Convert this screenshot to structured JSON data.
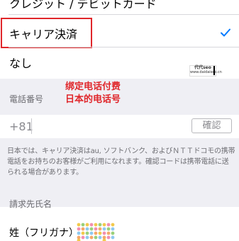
{
  "payment_options": {
    "credit_label": "クレジット / デビットカード",
    "carrier_label": "キャリア決済",
    "none_label": "なし",
    "selected": "carrier",
    "accent_color": "#007aff"
  },
  "phone_section": {
    "header": "電話番号",
    "country_code": "+81",
    "verify_label": "確認"
  },
  "annotation": {
    "line1": "绑定电话付费",
    "line2": "日本的电话号",
    "color": "#e0262a"
  },
  "watermark": {
    "line1": "代代seo",
    "line2": "www.daidaiseo.cn"
  },
  "notice_text": "日本では、キャリア決済はau, ソフトバンク、およびＮＴＴドコモの携帯電話をお持ちのお客様がご利用になれます。確認コードは携帯電話に送られる場合があります。",
  "billing": {
    "header": "請求先氏名",
    "surname_label": "姓（フリガナ）"
  },
  "icons": {
    "selected_mark": "checkmark-icon"
  }
}
